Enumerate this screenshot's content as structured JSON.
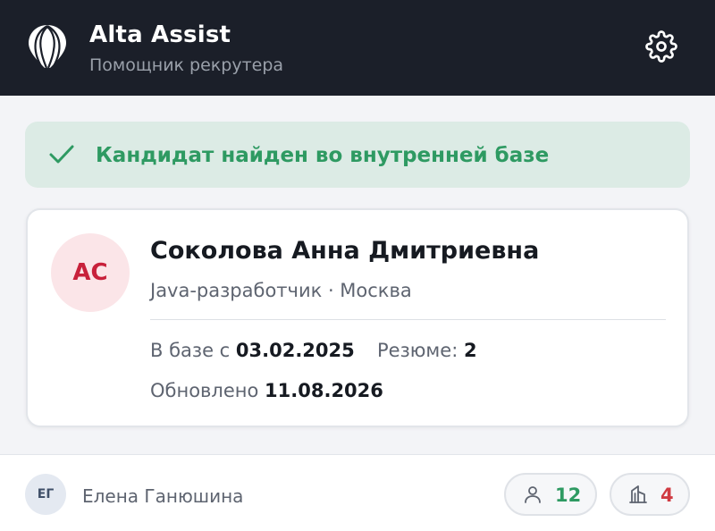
{
  "header": {
    "title": "Alta Assist",
    "subtitle": "Помощник рекрутера",
    "logo_icon": "hot-air-balloon-logo",
    "settings_icon": "gear-icon"
  },
  "alert": {
    "icon": "check-icon",
    "text": "Кандидат найден во внутренней базе",
    "color": "#2e9a62",
    "background": "#dcebe5"
  },
  "candidate": {
    "initials": "АС",
    "name": "Соколова Анна Дмитриевна",
    "role": "Java-разработчик · Москва",
    "added_label": "В базе с",
    "added_date": "03.02.2025",
    "resume_label": "Резюме:",
    "resume_count": "2",
    "updated_label": "Обновлено",
    "updated_date": "11.08.2026"
  },
  "footer": {
    "user_initials": "ЕГ",
    "user_name": "Елена Ганюшина",
    "candidates_icon": "person-icon",
    "candidates_count": "12",
    "companies_icon": "building-icon",
    "companies_count": "4"
  }
}
